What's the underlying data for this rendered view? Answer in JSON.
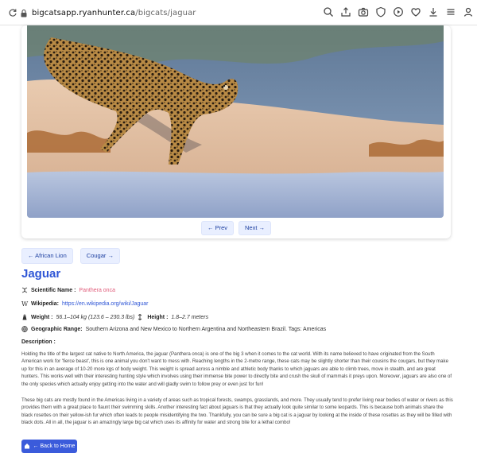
{
  "browser": {
    "url_host": "bigcatsapp.ryanhunter.ca",
    "url_path": "/bigcats/jaguar",
    "actions": [
      "search-icon",
      "share-icon",
      "camera-icon",
      "shield-icon",
      "play-icon",
      "heart-icon",
      "download-icon",
      "menu-lines-icon",
      "profile-icon"
    ]
  },
  "gallery": {
    "prev_label": "← Prev",
    "next_label": "Next →"
  },
  "neighbors": {
    "previous_label": "← African Lion",
    "next_label": "Cougar →"
  },
  "cat": {
    "name": "Jaguar",
    "scientific_label": "Scientific Name :",
    "scientific_value": "Panthera onca",
    "wiki_label": "Wikipedia:",
    "wiki_url": "https://en.wikipedia.org/wiki/Jaguar",
    "weight_label": "Weight :",
    "weight_value": "56.1–104 kg (123.6 – 230.3 lbs)",
    "height_label": "Height :",
    "height_value": "1.8–2.7 meters",
    "range_label": "Geographic Range:",
    "range_value": "Southern Arizona and New Mexico to Northern Argentina and Northeastern Brazil. Tags: Americas",
    "description_label": "Description :",
    "description_p1": "Holding the title of the largest cat native to North America, the jaguar (Panthera onca) is one of the big 3 when it comes to the cat world. With its name believed to have originated from the South American work for 'fierce beast', this is one animal you don't want to mess with. Reaching lengths in the 2-metre range, these cats may be slightly shorter than their cousins the cougars, but they make up for this in an average of 10-20 more kgs of body weight. This weight is spread across a nimble and athletic body thanks to which jaguars are able to climb trees, move in stealth, and are great hunters. This works well with their interesting hunting style which involves using their immense bite power to directly bite and crush the skull of mammals it preys upon. Moreover, jaguars are also one of the only species which actually enjoy getting into the water and will gladly swim to follow prey or even just for fun!",
    "description_p2": "These big cats are mostly found in the Americas living in a variety of areas such as tropical forests, swamps, grasslands, and more. They usually tend to prefer living near bodies of water or rivers as this provides them with a great place to flaunt their swimming skills. Another interesting fact about jaguars is that they actually look quite similar to some leopards. This is because both animals share the black rosettes on their yellow-ish fur which often leads to people misidentifying the two. Thankfully, you can be sure a big cat is a jaguar by looking at the inside of these rosettes as they will be filled with black dots. All in all, the jaguar is an amazingly large big cat which uses its affinity for water and strong bite for a lethal combo!"
  },
  "footer": {
    "back_label": "← Back to Home"
  },
  "colors": {
    "accent": "#2f56d6",
    "button_bg": "#3b5bdb",
    "latin": "#e05a78",
    "pill_bg": "#e9efff"
  }
}
